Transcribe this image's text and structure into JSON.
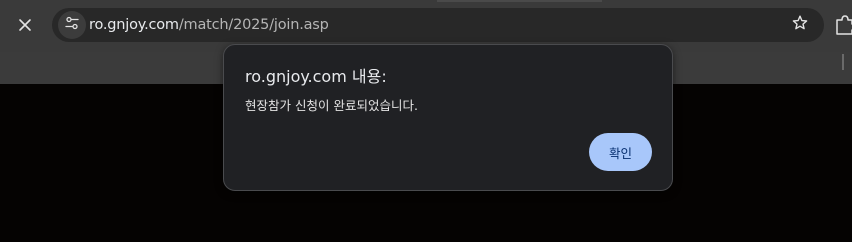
{
  "browser": {
    "url_domain": "ro.gnjoy.com",
    "url_path": "/match/2025/join.asp",
    "icons": {
      "close_tab": "close-icon",
      "site_info": "tune-icon",
      "bookmark": "star-icon",
      "extensions": "puzzle-icon"
    }
  },
  "dialog": {
    "title": "ro.gnjoy.com 내용:",
    "message": "현장참가 신청이 완료되었습니다.",
    "confirm_label": "확인"
  },
  "colors": {
    "toolbar": "#3a3a3a",
    "omnibox": "#282828",
    "page_background": "#050302",
    "dialog_background": "#202124",
    "button_background": "#a8c7fa",
    "button_text": "#062e6f"
  }
}
